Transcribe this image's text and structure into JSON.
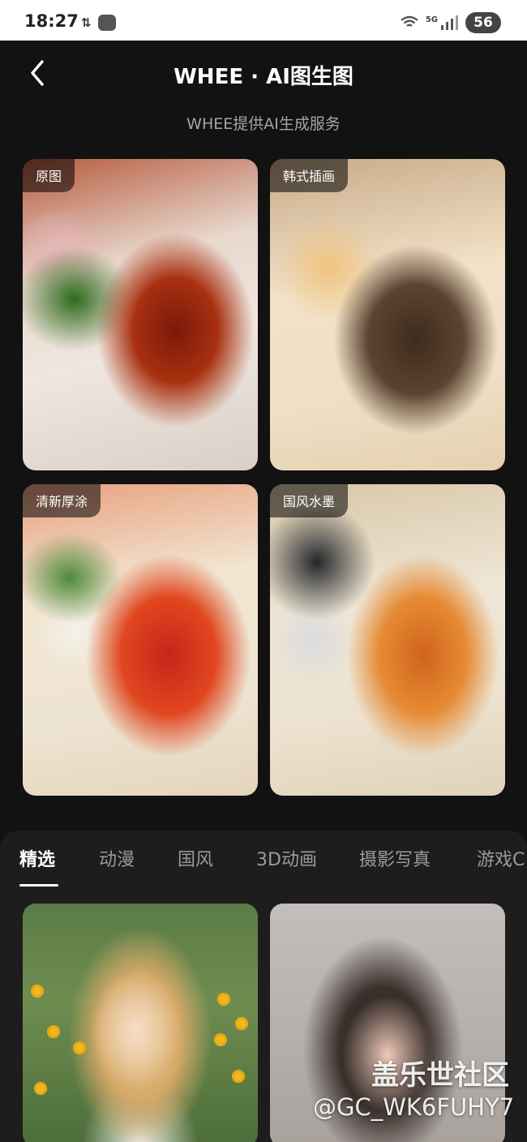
{
  "status_bar": {
    "time": "18:27",
    "network_label": "5G",
    "battery": "56"
  },
  "header": {
    "title": "WHEE · AI图生图",
    "subtitle": "WHEE提供AI生成服务"
  },
  "comparison": [
    {
      "tag": "原图"
    },
    {
      "tag": "韩式插画"
    },
    {
      "tag": "清新厚涂"
    },
    {
      "tag": "国风水墨"
    }
  ],
  "tabs": [
    {
      "label": "精选",
      "active": true
    },
    {
      "label": "动漫",
      "active": false
    },
    {
      "label": "国风",
      "active": false
    },
    {
      "label": "3D动画",
      "active": false
    },
    {
      "label": "摄影写真",
      "active": false
    },
    {
      "label": "游戏C",
      "active": false
    }
  ],
  "watermark": {
    "main": "盖乐世社区",
    "handle": "@GC_WK6FUHY7"
  },
  "colors": {
    "background": "#121212",
    "sheet": "#1d1d1d",
    "tab_inactive": "#9a9a9a",
    "subtitle": "#a4a4a4"
  }
}
